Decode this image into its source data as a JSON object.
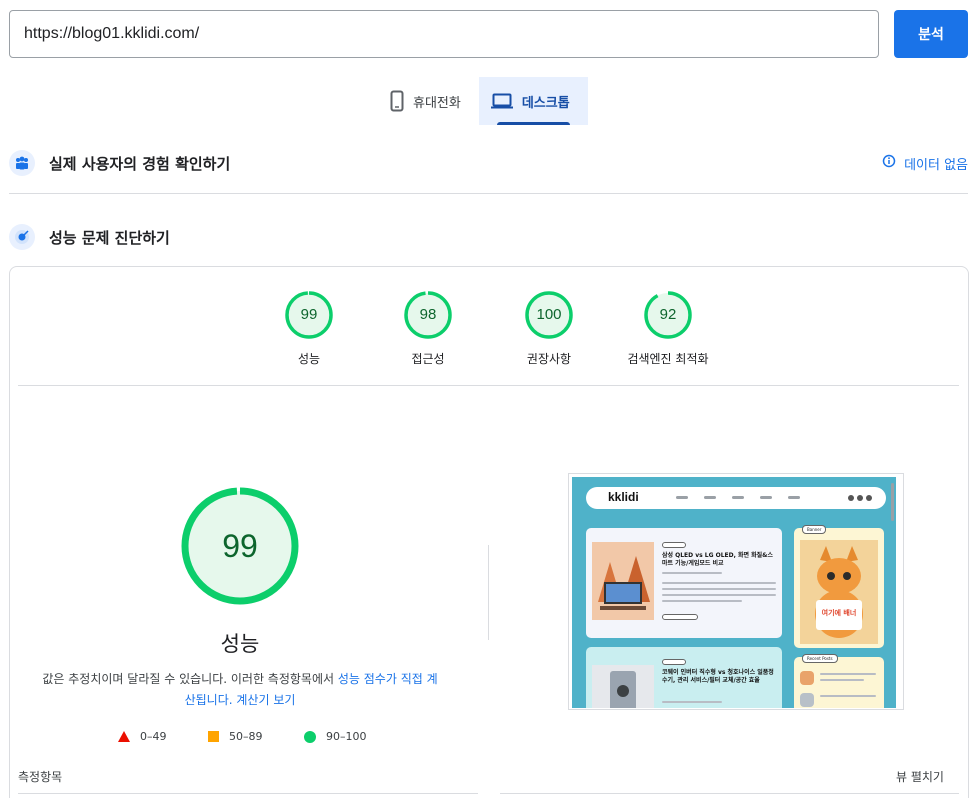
{
  "search": {
    "url": "https://blog01.kklidi.com/",
    "analyze_label": "분석"
  },
  "device_tabs": [
    {
      "label": "휴대전화",
      "icon": "phone-icon",
      "active": false
    },
    {
      "label": "데스크톱",
      "icon": "laptop-icon",
      "active": true
    }
  ],
  "field_data": {
    "title": "실제 사용자의 경험 확인하기",
    "no_data_label": "데이터 없음"
  },
  "lab": {
    "title": "성능 문제 진단하기"
  },
  "scores": [
    {
      "label": "성능",
      "value": 99
    },
    {
      "label": "접근성",
      "value": 98
    },
    {
      "label": "권장사항",
      "value": 100
    },
    {
      "label": "검색엔진 최적화",
      "value": 92
    }
  ],
  "main_score": {
    "value": 99,
    "label": "성능"
  },
  "description": {
    "text": "값은 추정치이며 달라질 수 있습니다. 이러한 측정항목에서 ",
    "link1": "성능 점수가 직접 계산됩니다.",
    "link2": "계산기 보기"
  },
  "legend": [
    {
      "range": "0–49",
      "shape": "triangle",
      "color": "#eb0f00"
    },
    {
      "range": "50–89",
      "shape": "square",
      "color": "#ffa400"
    },
    {
      "range": "90–100",
      "shape": "circle",
      "color": "#0cce6b"
    }
  ],
  "screenshot": {
    "logo": "kklidi",
    "post1_title": "삼성 QLED vs LG OLED, 화면 화질&스마트 기능/게임모드 비교",
    "post2_title": "코웨이 인버터 직수형 vs 청호나이스 일품정수기, 관리 서비스/필터 교체/공간 효율",
    "banner_tag": "Banner",
    "banner_text": "여기에 배너",
    "recent_tag": "Recent Posts"
  },
  "footer": {
    "metrics_label": "측정항목",
    "view_toggle": "뷰 펼치기"
  },
  "colors": {
    "accent": "#1a73e8",
    "pass": "#0cce6b",
    "pass_text": "#0d652d"
  }
}
